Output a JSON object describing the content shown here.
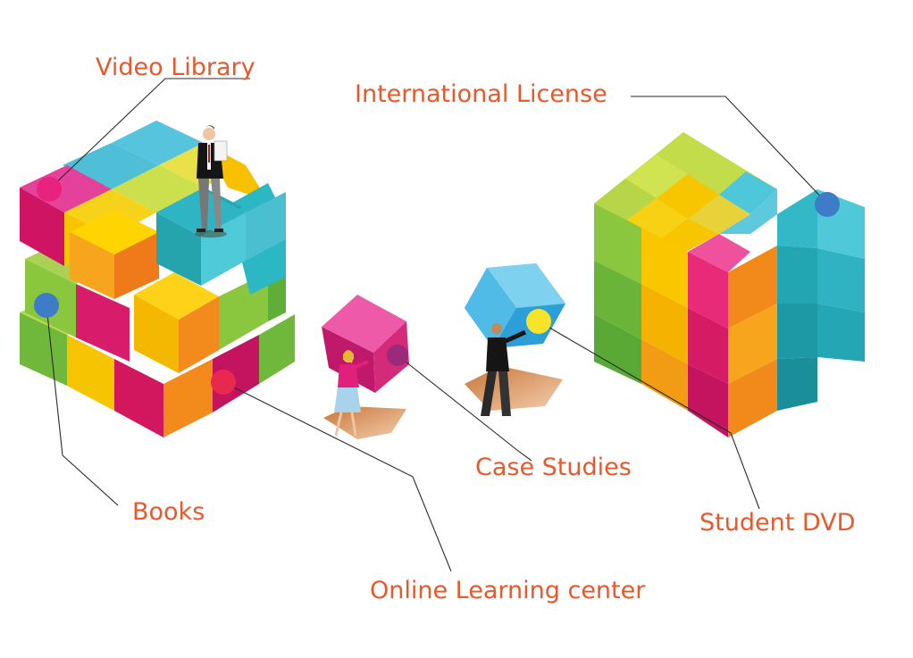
{
  "labels": {
    "video_library": "Video Library",
    "international_license": "International License",
    "books": "Books",
    "case_studies": "Case Studies",
    "student_dvd": "Student DVD",
    "online_learning_center": "Online Learning center"
  },
  "colors": {
    "label": "#e8582a",
    "pink": "#e8227f",
    "magenta": "#c4145f",
    "yellow": "#f9d200",
    "orange": "#f18a1a",
    "green": "#8bc63f",
    "lime": "#cde34a",
    "cyan": "#4cc5d9",
    "teal": "#1fa8b0",
    "dot_blue": "#3f7cc7",
    "dot_red": "#e8284f",
    "dot_purple": "#9a2a7a",
    "dot_yellow": "#f7e42a",
    "shadow": "#b85a1d"
  }
}
